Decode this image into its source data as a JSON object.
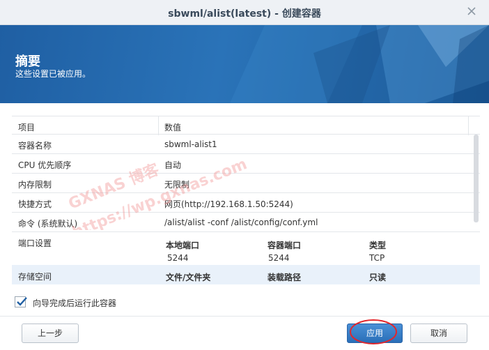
{
  "window": {
    "title": "sbwml/alist(latest) - 创建容器"
  },
  "banner": {
    "title": "摘要",
    "subtitle": "这些设置已被应用。"
  },
  "table": {
    "headers": {
      "item": "项目",
      "value": "数值"
    },
    "rows": [
      {
        "key": "容器名称",
        "value": "sbwml-alist1"
      },
      {
        "key": "CPU 优先顺序",
        "value": "自动"
      },
      {
        "key": "内存限制",
        "value": "无限制"
      },
      {
        "key": "快捷方式",
        "value": "网页(http://192.168.1.50:5244)"
      },
      {
        "key": "命令 (系统默认)",
        "value": "/alist/alist -conf /alist/config/conf.yml"
      }
    ],
    "ports": {
      "key": "端口设置",
      "headers": [
        "本地端口",
        "容器端口",
        "类型"
      ],
      "values": [
        "5244",
        "5244",
        "TCP"
      ]
    },
    "storage": {
      "key": "存储空间",
      "headers": [
        "文件/文件夹",
        "装载路径",
        "只读"
      ]
    }
  },
  "checkbox": {
    "label": "向导完成后运行此容器",
    "checked": true
  },
  "buttons": {
    "prev": "上一步",
    "apply": "应用",
    "cancel": "取消"
  },
  "watermark": {
    "line1": "GXNAS 博客",
    "line2": "https://wp.gxnas.com"
  },
  "colors": {
    "banner": "#2a73b8",
    "accent": "#2a6fb8",
    "highlight_ring": "#e3262b"
  }
}
